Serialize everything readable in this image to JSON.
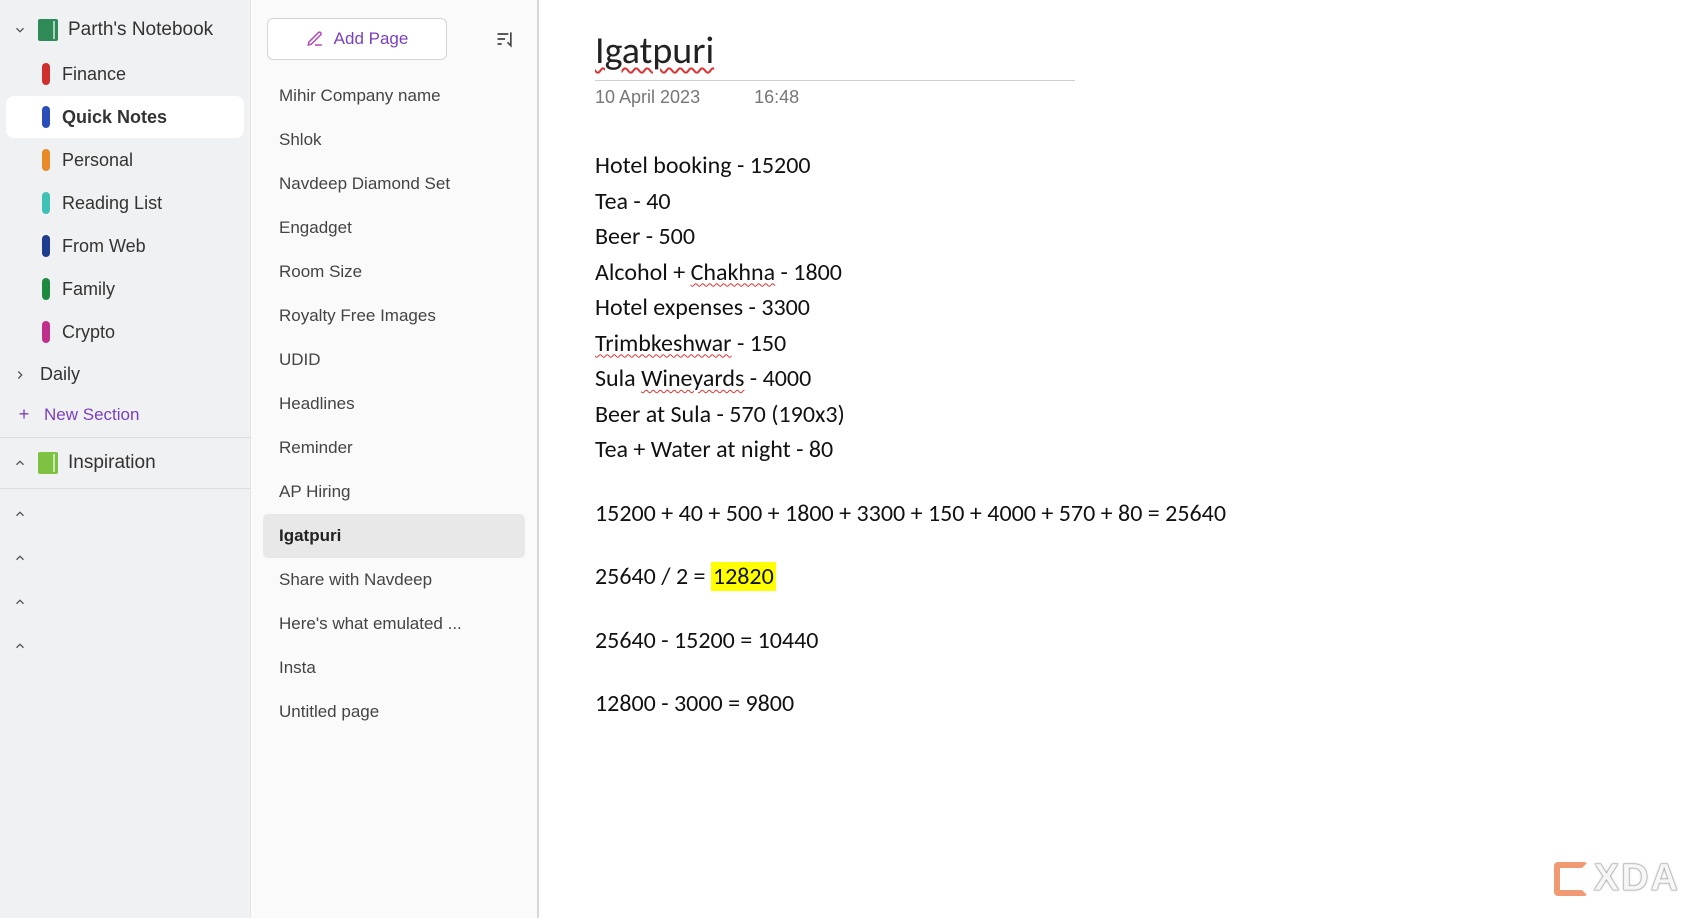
{
  "notebook": {
    "name": "Parth's Notebook",
    "icon_color": "#2e8b57"
  },
  "sections": [
    {
      "label": "Finance",
      "color": "#d12e2e",
      "selected": false
    },
    {
      "label": "Quick Notes",
      "color": "#2b4db8",
      "selected": true
    },
    {
      "label": "Personal",
      "color": "#e88a2a",
      "selected": false
    },
    {
      "label": "Reading List",
      "color": "#3fc1b6",
      "selected": false
    },
    {
      "label": "From Web",
      "color": "#1f3d8f",
      "selected": false
    },
    {
      "label": "Family",
      "color": "#1e8a3f",
      "selected": false
    },
    {
      "label": "Crypto",
      "color": "#c12f8c",
      "selected": false
    }
  ],
  "daily_label": "Daily",
  "new_section": "New Section",
  "inspiration_label": "Inspiration",
  "add_page": "Add Page",
  "pages": [
    "Mihir Company name",
    "Shlok",
    "Navdeep Diamond Set",
    "Engadget",
    "Room Size",
    "Royalty Free Images",
    "UDID",
    "Headlines",
    "Reminder",
    "AP Hiring",
    "Igatpuri",
    "Share with Navdeep",
    "Here's what emulated ...",
    "Insta",
    "Untitled page"
  ],
  "selected_page_index": 10,
  "note": {
    "title": "Igatpuri",
    "date": "10 April 2023",
    "time": "16:48",
    "body_lines": [
      {
        "text": "Hotel booking - 15200"
      },
      {
        "parts": [
          "Tea - 40"
        ]
      },
      {
        "parts": [
          "Beer - 500"
        ]
      },
      {
        "parts": [
          "Alcohol + ",
          {
            "squiggle": "Chakhna"
          },
          " - 1800"
        ]
      },
      {
        "parts": [
          "Hotel expenses - 3300"
        ]
      },
      {
        "parts": [
          {
            "squiggle": "Trimbkeshwar"
          },
          " - 150"
        ]
      },
      {
        "parts": [
          "Sula ",
          {
            "squiggle": "Wineyards"
          },
          " - 4000"
        ]
      },
      {
        "parts": [
          "Beer at Sula - 570 (190x3)"
        ]
      },
      {
        "parts": [
          "Tea + Water at night - 80"
        ]
      },
      {
        "gap": true
      },
      {
        "parts": [
          "15200 + 40 + 500 + 1800 + 3300 + 150 + 4000 + 570 + 80 = 25640"
        ]
      },
      {
        "gap": true
      },
      {
        "parts": [
          "25640 / 2 = ",
          {
            "hl": "12820"
          }
        ]
      },
      {
        "gap": true
      },
      {
        "parts": [
          "25640 - 15200 = 10440"
        ]
      },
      {
        "gap": true
      },
      {
        "parts": [
          "12800 - 3000 = 9800"
        ]
      }
    ]
  },
  "watermark": "XDA"
}
